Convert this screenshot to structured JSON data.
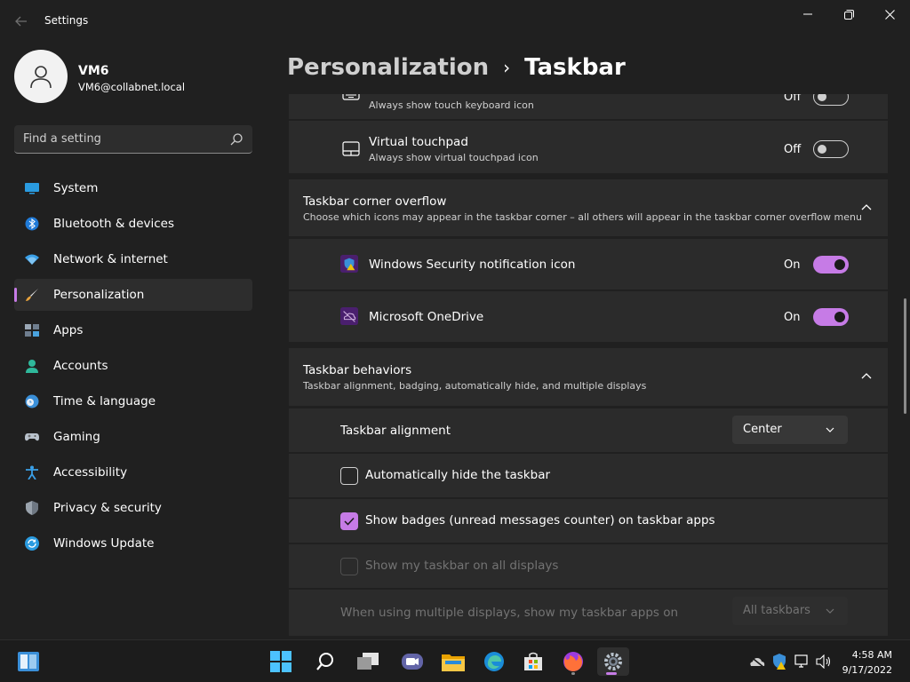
{
  "window": {
    "title": "Settings"
  },
  "profile": {
    "name": "VM6",
    "email": "VM6@collabnet.local"
  },
  "search": {
    "placeholder": "Find a setting"
  },
  "sidebar": {
    "items": [
      {
        "label": "System",
        "icon": "system-icon"
      },
      {
        "label": "Bluetooth & devices",
        "icon": "bluetooth-icon"
      },
      {
        "label": "Network & internet",
        "icon": "wifi-icon"
      },
      {
        "label": "Personalization",
        "icon": "brush-icon",
        "selected": true
      },
      {
        "label": "Apps",
        "icon": "apps-icon"
      },
      {
        "label": "Accounts",
        "icon": "account-icon"
      },
      {
        "label": "Time & language",
        "icon": "clock-globe-icon"
      },
      {
        "label": "Gaming",
        "icon": "gamepad-icon"
      },
      {
        "label": "Accessibility",
        "icon": "accessibility-icon"
      },
      {
        "label": "Privacy & security",
        "icon": "shield-icon"
      },
      {
        "label": "Windows Update",
        "icon": "update-icon"
      }
    ]
  },
  "breadcrumb": {
    "parent": "Personalization",
    "separator": "›",
    "current": "Taskbar"
  },
  "corner_icons": {
    "touch_keyboard": {
      "description": "Always show touch keyboard icon",
      "state": "Off"
    },
    "virtual_touchpad": {
      "title": "Virtual touchpad",
      "description": "Always show virtual touchpad icon",
      "state": "Off"
    }
  },
  "corner_overflow": {
    "title": "Taskbar corner overflow",
    "description": "Choose which icons may appear in the taskbar corner – all others will appear in the taskbar corner overflow menu",
    "items": [
      {
        "label": "Windows Security notification icon",
        "state": "On"
      },
      {
        "label": "Microsoft OneDrive",
        "state": "On"
      }
    ]
  },
  "behaviors": {
    "title": "Taskbar behaviors",
    "description": "Taskbar alignment, badging, automatically hide, and multiple displays",
    "alignment_label": "Taskbar alignment",
    "alignment_value": "Center",
    "auto_hide_label": "Automatically hide the taskbar",
    "badges_label": "Show badges (unread messages counter) on taskbar apps",
    "all_displays_label": "Show my taskbar on all displays",
    "multi_display_label": "When using multiple displays, show my taskbar apps on",
    "multi_display_value": "All taskbars"
  },
  "clock": {
    "time": "4:58 AM",
    "date": "9/17/2022"
  },
  "colors": {
    "accent": "#c67be6",
    "background": "#202020",
    "card": "#2b2b2b"
  }
}
